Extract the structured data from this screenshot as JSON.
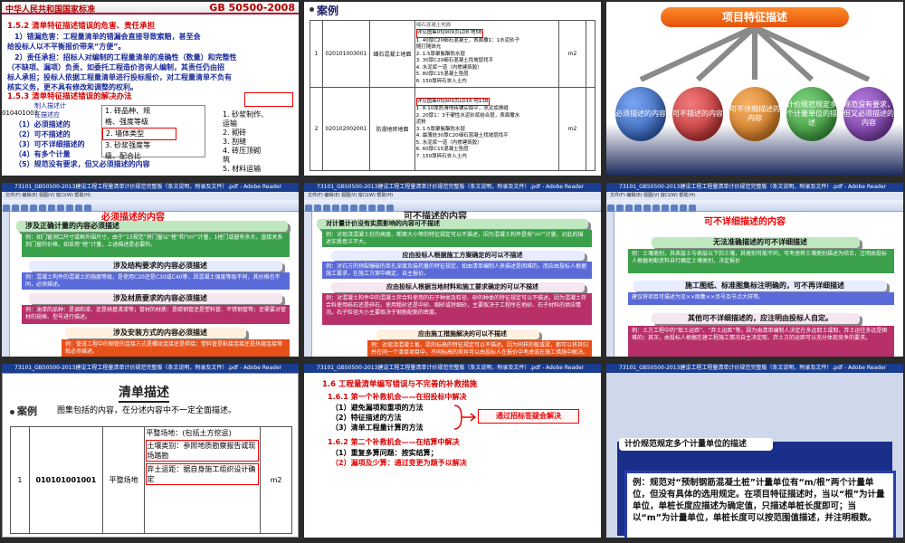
{
  "s1": {
    "header_left": "中华人民共和国国家标准",
    "header_right": "GB 50500-2008",
    "sec_152": "1.5.2  清单特征描述错误的危害、责任承担",
    "p1a": "1）错漏危害：工程量清单的错漏会直接导致索赔，甚至会",
    "p1b": "给投标人以不平衡报价带来“方便”。",
    "p2a": "2）责任承担：招标人对编制的工程量清单的准确性（数量）和完整性",
    "p2b": "（不缺项、漏项）负责，如委托工程造价咨询人编制，其责任仍由招",
    "p2c": "标人承担；投标人依据工程量清单进行投标报价，对工程量清单不负有",
    "p2d": "核实义务，更不具有修改和调整的权利。",
    "sec_153": "1.5.3  清单特征描述错误的解决办法",
    "code": "010401003",
    "l1": "（1）必须描述的",
    "l2": "（2）可不描述的",
    "l3": "（3）可不详细描述的",
    "l4": "（4）有多个计量",
    "l5": "（5）规范没有要求，但又必须描述的内容",
    "mid1": "1. 砖品种、规",
    "mid2": "格、强度等级",
    "mid3": "2. 墙体类型",
    "mid4": "3. 砂浆强度等",
    "mid5": "级、配合比",
    "right1": "1. 砂浆制作、",
    "right2": "运输",
    "right3": "2. 砌砖",
    "right4": "3. 刮缝",
    "right5": "4. 砖压顶砌",
    "right6": "筑",
    "right7": "5. 材料运输",
    "small1": "制人描述计",
    "small2": "征描述应"
  },
  "s2": {
    "title": "案例",
    "rows": [
      {
        "no": "1",
        "code": "020101003001",
        "name": "细石混凝土地面",
        "unit": "m2",
        "lines": [
          "详见图集05J909页LD8  地5B",
          "1. 40厚C20细石混凝土，表面撒1：1水泥砂子",
          "随打随抹光",
          "2. 1.5厚聚氨酯防水层",
          "3. 30厚C20细石混凝土找坡层找平",
          "4. 水泥浆一道（内掺建筑胶）",
          "5. 80厚C15混凝土垫层",
          "6. 150厚碎石夯入土内"
        ]
      },
      {
        "no": "2",
        "code": "020102002001",
        "name": "防滑地砖地面",
        "unit": "m2",
        "lines": [
          "详见图集05J909页LD16  地13B",
          "1. 8-10厚防滑地砖铺实拍平，水泥浆擦缝",
          "2. 20厚1：3干硬性水泥砂浆结合层，表面撒水",
          "泥粉",
          "3. 1.5厚聚氨酯防水层",
          "4. 最薄处30厚C20细石混凝土找坡层找平",
          "5. 水泥浆一道（内掺建筑胶）",
          "6. 60厚C15混凝土垫层",
          "7. 150厚碎石夯入土内"
        ]
      }
    ],
    "top_label": "细石混凝土地面"
  },
  "s3": {
    "title": "项目特征描述",
    "orbs": [
      "必须描述的内容",
      "可不描述的内容",
      "可不详细描述的内容",
      "计价规范规定多个计量单位的描述",
      "规范没有要求，但又必须描述的内容"
    ],
    "colors": [
      "#2a5fb8",
      "#c02828",
      "#d07a1a",
      "#3a9a3a",
      "#7a3aa8"
    ]
  },
  "acro": {
    "title": "73101_GB50500-2013建设工程工程量清单计价规范完整版（条文说明，附录及文件）.pdf - Adobe Reader",
    "menu": "文件(F)  编辑(E)  视图(V)  窗口(W)  帮助(H)"
  },
  "s4": {
    "heading": "必须描述的内容",
    "b1": "涉及正确计量的内容必须描述",
    "t1": "例：如门窗洞口尺寸或框外围尺寸，由于“13规范”将门窗以“樘”和“m²”计量，1樘门或窗有多大，直接关系到门窗的价格，如采用“樘”计量，上述描述是必要的。",
    "b2": "涉及结构要求的内容必须描述",
    "t2": "例：混凝土构件的混凝土的强度等级，是使用C20还是C30或C40等，因混凝土强度等级不同，其价格也不同，必须描述。",
    "b3": "涉及材质要求的内容必须描述",
    "t3": "例：油漆的品种：是调和漆、还是硝基清漆等；管材的材质：是碳钢管还是塑料管、不锈钢管等；还需要对管材的规格、型号进行描述。",
    "b4": "涉及安装方式的内容必须描述",
    "t4": "例：管道工程中的钢管的连接方式是螺纹连接还是焊接；塑料管是粘接连接还是热熔连接等就必须描述。"
  },
  "s5": {
    "heading": "可不描述的内容",
    "b1": "对计量计价没有实质影响的内容可不描述",
    "t1": "例：对现浇混凝土柱的高度、断面大小等的特征规定可以不描述，因为混凝土构件是按“m³”计量，对此的描述实质意义不大。",
    "b2": "应由投标人根据施工方案确定的可以不描述",
    "t2": "例：对石方的预裂爆破的单孔深度及装药量的特征规定，如由清单编制人来描述是困难的，而应由投标人根据施工要求，在施工方案中确定，自主报价。",
    "b3": "应由投标人根据当地材料和施工要求确定的可以不描述",
    "t3": "例：对混凝土构件中的混凝土拌合料使用的石子种类及粒径、砂的种类的特征规定可以不描述。因为混凝土拌合料使用砾石还是碎石，使用粗砂还是中砂、细砂或特细砂，主要取决于工程所在地砂、石子材料的供应情况。石子粒径大小主要取决于钢筋配筋的密度。",
    "b4": "应由施工措施解决的可以不描述",
    "t4": "例：对现浇混凝土板、梁的标高的特征规定可以不描述。因为同样的板或梁，都可以将其归并在同一个清单项目中，不同标高的差异可以由投标人在报价中考虑或在施工措施中解决。"
  },
  "s6": {
    "heading": "可不详细描述的内容",
    "b1": "无法准确描述的可不详细描述",
    "t1": "例：土壤类别，其表层土与表层以下的土壤，其类别可能不同，可考虑将土壤类别描述为综合，注明由投标人根据地勘资料自行确定土壤类别，决定报价",
    "b2": "施工图纸、标准图集标注明确的，可不再详细描述",
    "t2": "建议将项目可描述为见××图集××页号及节点大样等。",
    "b3": "其他可不详细描述的，应注明由投标人自定。",
    "t3": "例：土方工程中的“取土运距”、“弃土运距”等。因为由清单编制人决定在多远取土或取、弃土运往多远是困难的；其次，由投标人根据在建工程施工情况自主决定取、弃土方的运距可以充分体现竞争的要求。"
  },
  "s7": {
    "title": "清单描述",
    "case_label": "案例",
    "case_text": "图集包括的内容，在分述内容中不一定全面描述。",
    "no": "1",
    "code": "010101001001",
    "name": "平整场地",
    "unit": "m2",
    "c1": "平整场地：(包括土方挖运)",
    "c2": "土壤类别：参照地质勘察报告或现场踏勘",
    "c3": "弃土运距：据自身施工组织设计确定"
  },
  "s8": {
    "sec16": "1.6  工程量清单编写错误与不完善的补救措施",
    "sub1": "1.6.1  第一个补救机会——在招投标中解决",
    "i1": "（1）避免漏项和重项的方法",
    "i2": "（2）特征描述的方法",
    "i3": "（3）清单工程量计算的方法",
    "callout": "通过招标答疑会解决",
    "sub2": "1.6.2  第二个补救机会——在结算中解决",
    "i4": "（1）重复多算问题：按实结算；",
    "i5": "（2）漏项及少算：通过变更为题予以解决"
  },
  "s9": {
    "heading": "计价规范规定多个计量单位的描述",
    "text": "例：规范对“预制钢筋混凝土桩”计量单位有“m/根”两个计量单位，但没有具体的选用规定。在项目特征描述时，当以“根”为计量单位，单桩长度应描述为确定值，只描述单桩长度即可；当以“m”为计量单位，单桩长度可以按范围值描述，并注明根数。"
  }
}
